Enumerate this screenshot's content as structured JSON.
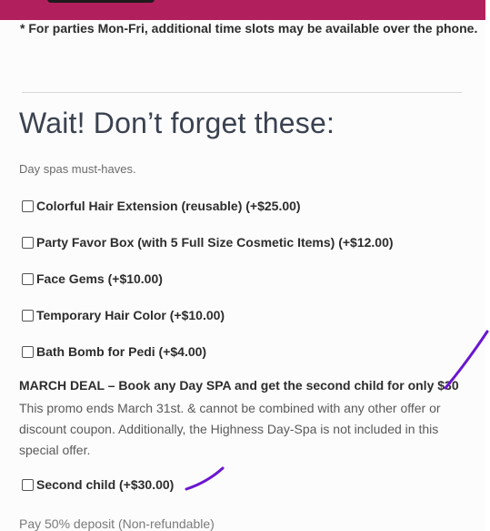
{
  "note": "* For parties Mon-Fri, additional time slots may be available over the phone.",
  "heading": "Wait! Don’t forget these:",
  "subtitle": "Day spas must-haves.",
  "addons": [
    {
      "label": "Colorful Hair Extension (reusable) (+$25.00)"
    },
    {
      "label": "Party Favor Box (with 5 Full Size Cosmetic Items) (+$12.00)"
    },
    {
      "label": "Face Gems (+$10.00)"
    },
    {
      "label": "Temporary Hair Color (+$10.00)"
    },
    {
      "label": "Bath Bomb for Pedi (+$4.00)"
    }
  ],
  "deal": {
    "title": "MARCH DEAL – Book any Day SPA and get the second child for only $30",
    "text": "This promo ends March 31st. & cannot be combined with any other offer or discount coupon. Additionally, the Highness Day-Spa is not included in this special offer."
  },
  "second_child": {
    "label": "Second child (+$30.00)"
  },
  "deposit": "Pay 50% deposit (Non-refundable)",
  "colors": {
    "banner": "#b11f5d",
    "annotation": "#6a16d0"
  }
}
